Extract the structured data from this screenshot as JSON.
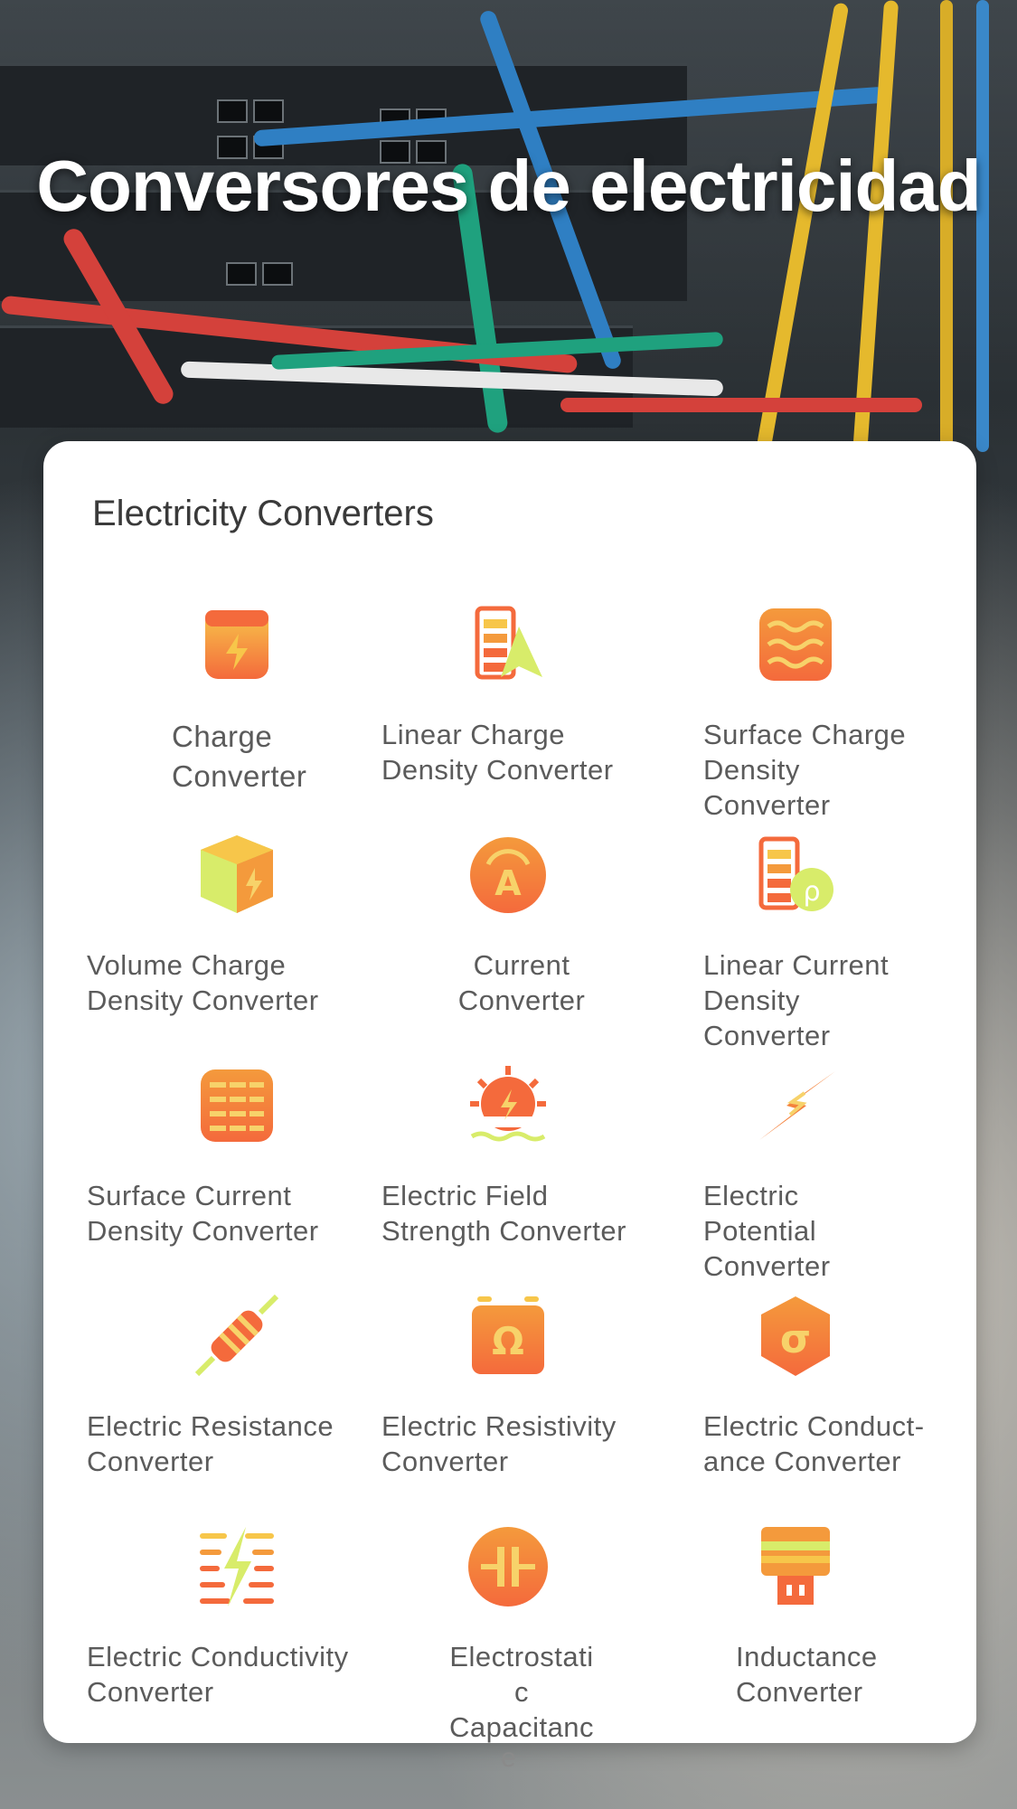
{
  "hero": {
    "title": "Conversores de electricidad"
  },
  "card": {
    "title": "Electricity Converters",
    "items": [
      {
        "icon": "charge-icon",
        "label_lines": [
          "Charge",
          "Converter"
        ]
      },
      {
        "icon": "linear-charge-density-icon",
        "label_lines": [
          "Linear Charge",
          "Density Converter"
        ]
      },
      {
        "icon": "surface-charge-density-icon",
        "label_lines": [
          "Surface Charge",
          "Density",
          "Converter"
        ]
      },
      {
        "icon": "volume-charge-density-icon",
        "label_lines": [
          "Volume Charge",
          "Density Converter"
        ]
      },
      {
        "icon": "current-icon",
        "label_lines": [
          "Current",
          "Converter"
        ]
      },
      {
        "icon": "linear-current-density-icon",
        "label_lines": [
          "Linear Current",
          "Density",
          "Converter"
        ]
      },
      {
        "icon": "surface-current-density-icon",
        "label_lines": [
          "Surface Current",
          "Density Converter"
        ]
      },
      {
        "icon": "electric-field-strength-icon",
        "label_lines": [
          "Electric Field",
          "Strength Converter"
        ]
      },
      {
        "icon": "electric-potential-icon",
        "label_lines": [
          "Electric",
          "Potential",
          "Converter"
        ]
      },
      {
        "icon": "electric-resistance-icon",
        "label_lines": [
          "Electric Resistance",
          "Converter"
        ]
      },
      {
        "icon": "electric-resistivity-icon",
        "label_lines": [
          "Electric Resistivity",
          "Converter"
        ]
      },
      {
        "icon": "electric-conductance-icon",
        "label_lines": [
          "Electric Conduct-",
          "ance Converter"
        ]
      },
      {
        "icon": "electric-conductivity-icon",
        "label_lines": [
          "Electric Conductivity",
          "Converter"
        ]
      },
      {
        "icon": "electrostatic-capacitance-icon",
        "label_lines": [
          "Electrostati",
          "c",
          "Capacitanc"
        ]
      },
      {
        "icon": "inductance-icon",
        "label_lines": [
          "Inductance",
          "Converter"
        ]
      }
    ],
    "overflow_text": "e"
  },
  "colors": {
    "icon_orange": "#f46a3c",
    "icon_yellow": "#f7c64a",
    "icon_lime": "#d8ec6a",
    "label": "#5b5b5b"
  }
}
